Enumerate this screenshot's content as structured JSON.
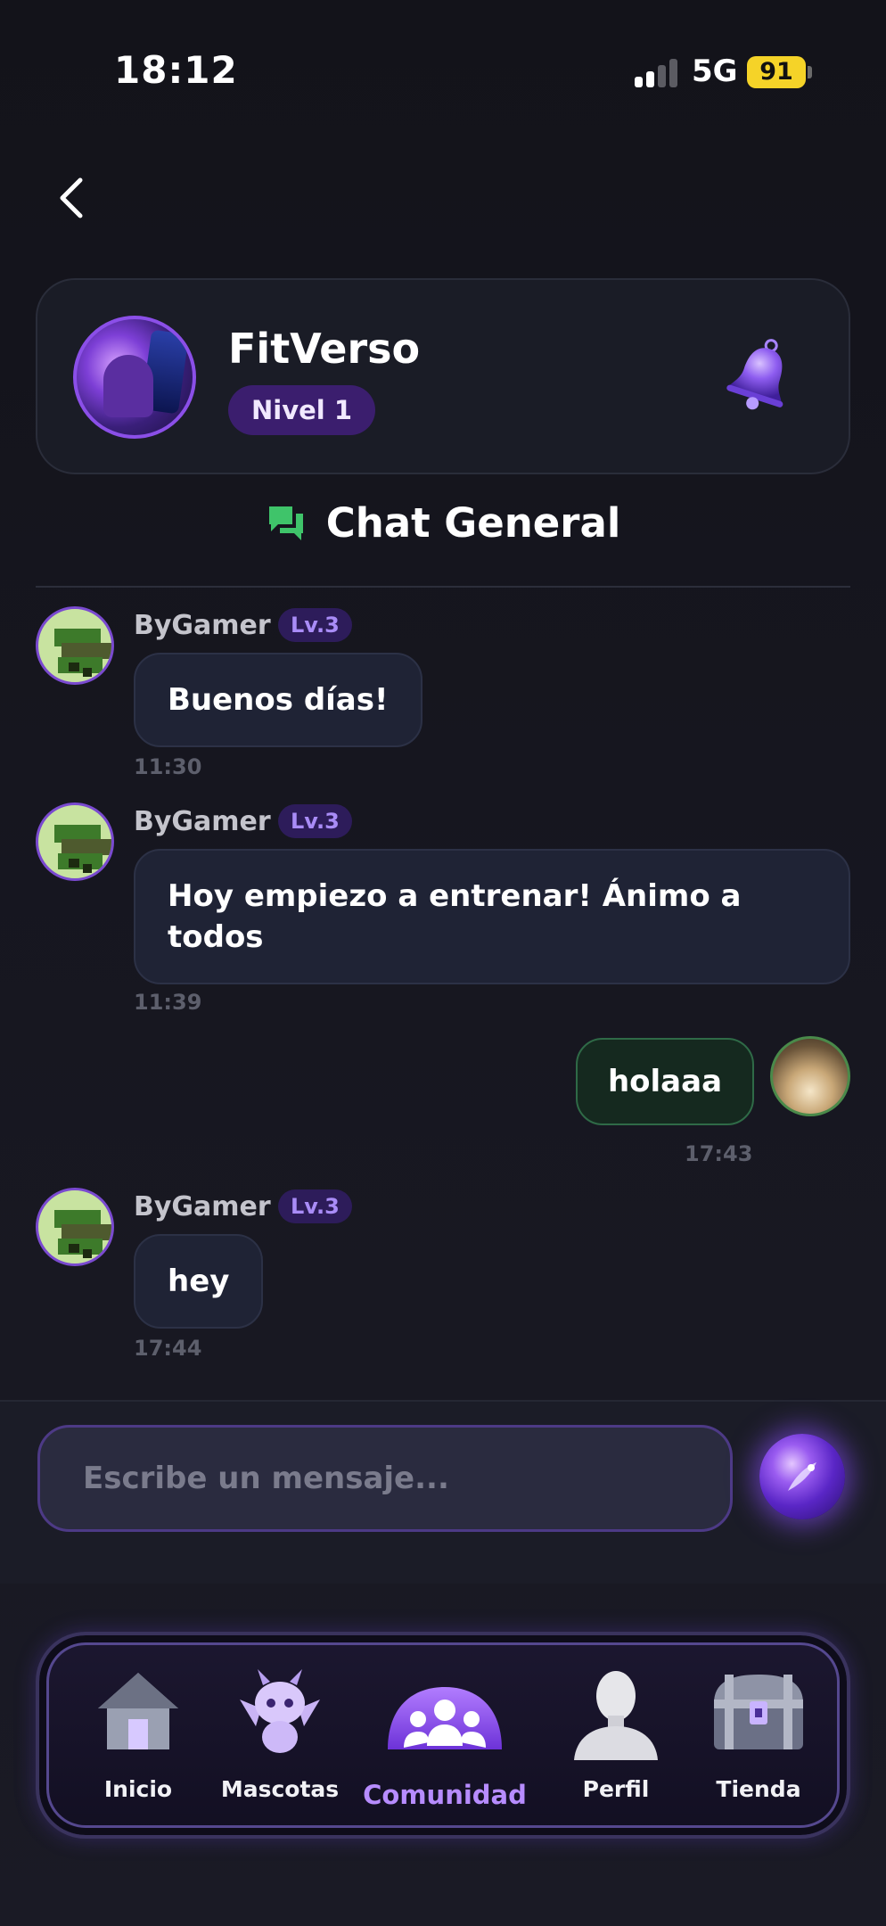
{
  "status": {
    "time": "18:12",
    "network": "5G",
    "battery": "91"
  },
  "header": {
    "app_name": "FitVerso",
    "level": "Nivel 1"
  },
  "chat": {
    "title": "Chat General"
  },
  "messages": [
    {
      "user": "ByGamer",
      "level": "Lv.3",
      "text": "Buenos días!",
      "time": "11:30"
    },
    {
      "user": "ByGamer",
      "level": "Lv.3",
      "text": "Hoy empiezo a entrenar! Ánimo a todos",
      "time": "11:39"
    },
    {
      "user": "",
      "level": "",
      "text": "holaaa",
      "time": "17:43",
      "own": true
    },
    {
      "user": "ByGamer",
      "level": "Lv.3",
      "text": "hey",
      "time": "17:44"
    }
  ],
  "composer": {
    "placeholder": "Escribe un mensaje..."
  },
  "nav": {
    "items": [
      {
        "label": "Inicio",
        "icon": "house-icon"
      },
      {
        "label": "Mascotas",
        "icon": "dragon-pet-icon"
      },
      {
        "label": "Comunidad",
        "icon": "community-icon",
        "active": true
      },
      {
        "label": "Perfil",
        "icon": "profile-bust-icon"
      },
      {
        "label": "Tienda",
        "icon": "treasure-chest-icon"
      }
    ]
  },
  "colors": {
    "accent": "#8b4fe8",
    "own_bubble_border": "#2f6a47",
    "chat_icon": "#3fc46a"
  }
}
